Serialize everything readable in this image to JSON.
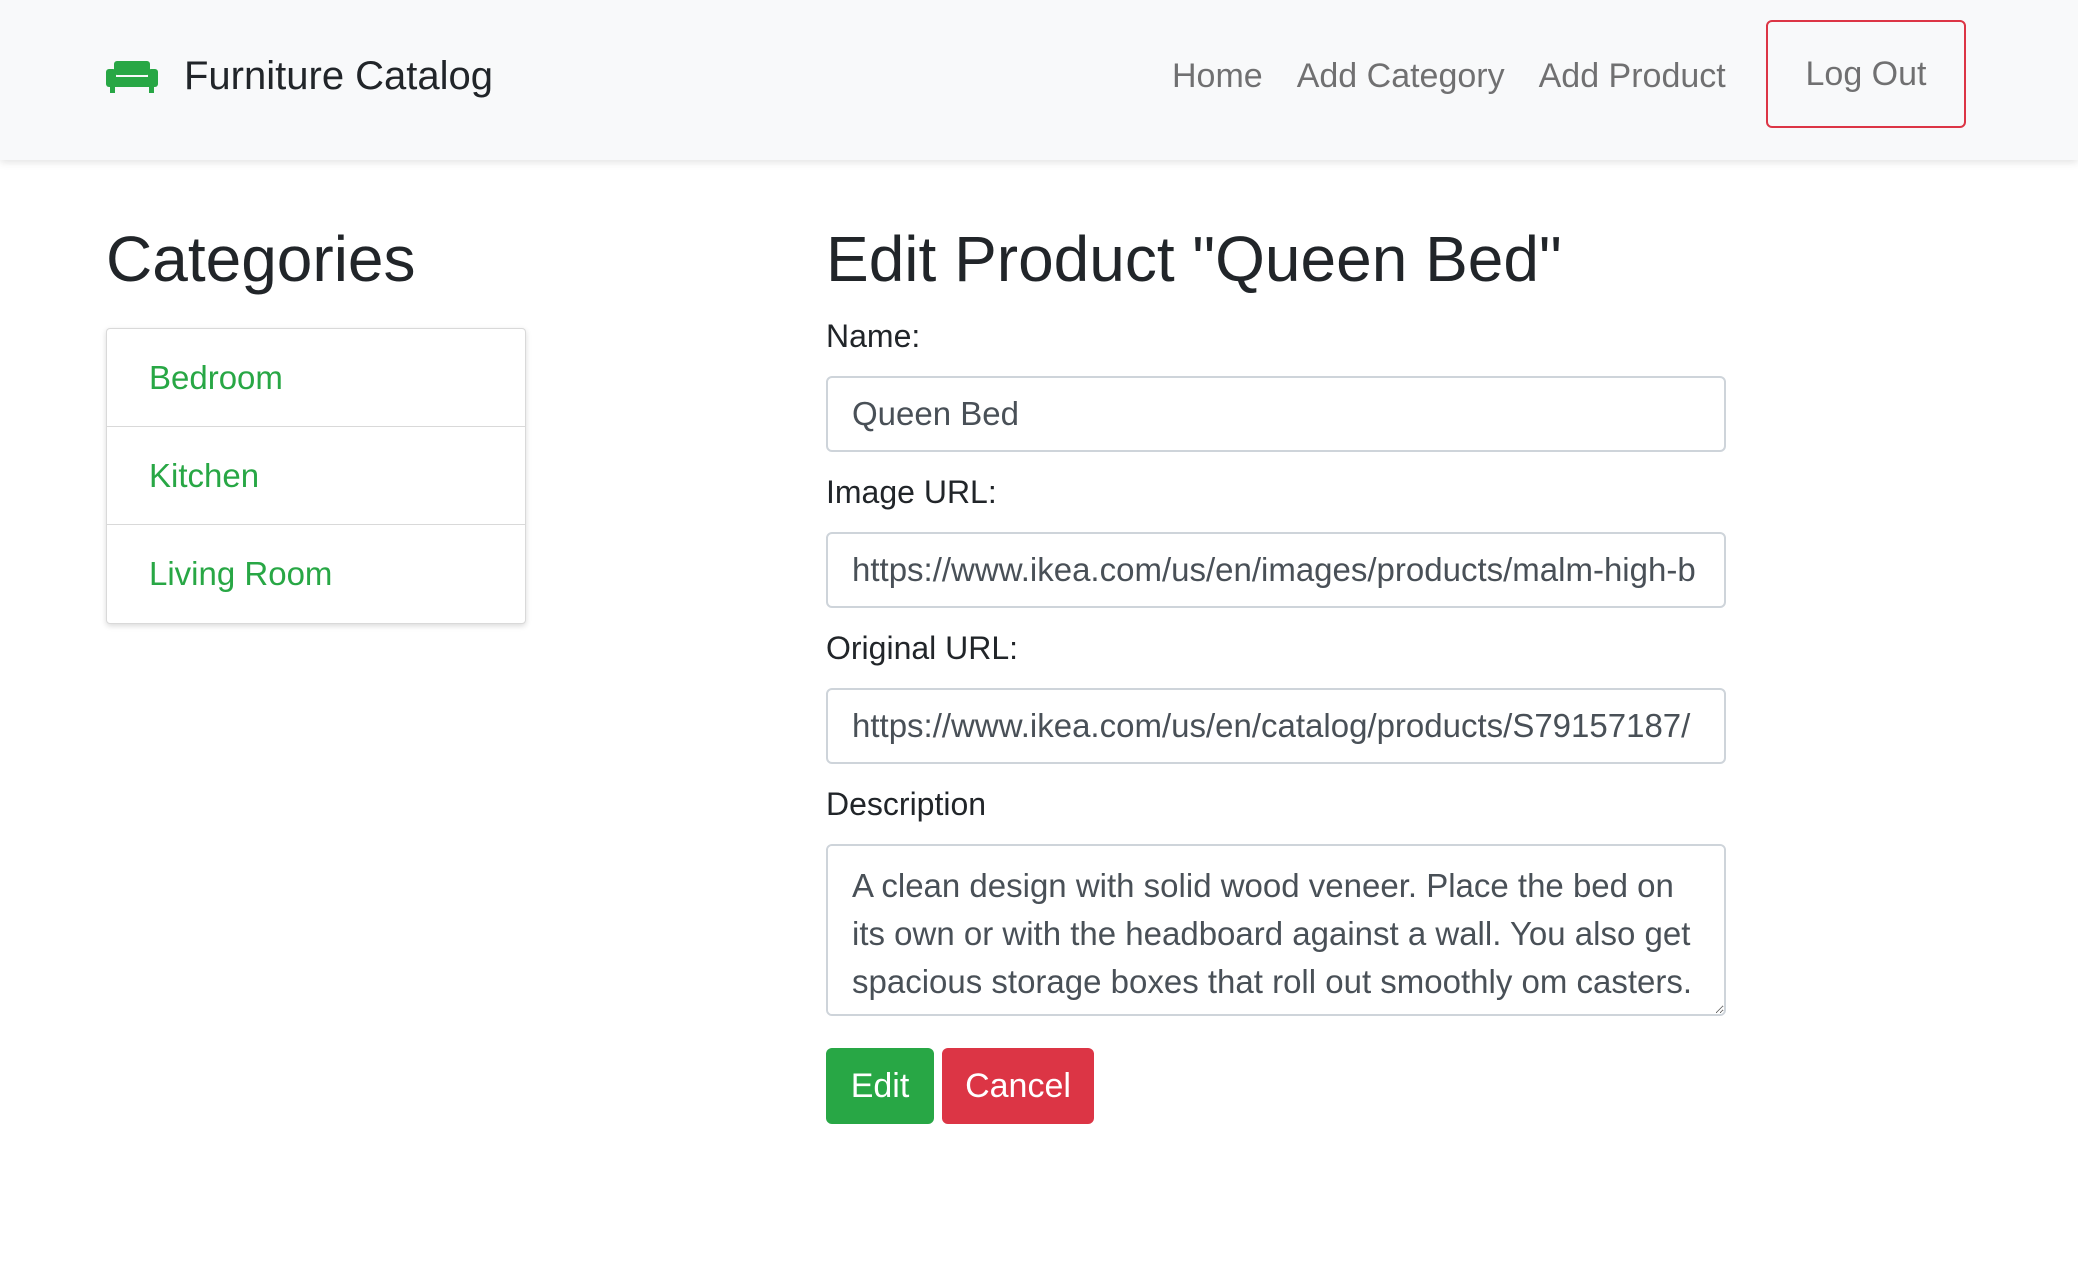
{
  "navbar": {
    "brand_icon": "sofa-icon",
    "brand": "Furniture Catalog",
    "links": [
      "Home",
      "Add Category",
      "Add Product"
    ],
    "logout_label": "Log Out"
  },
  "sidebar": {
    "title": "Categories",
    "items": [
      "Bedroom",
      "Kitchen",
      "Living Room"
    ]
  },
  "form": {
    "title": "Edit Product \"Queen Bed\"",
    "name_label": "Name:",
    "name_value": "Queen Bed",
    "image_label": "Image URL:",
    "image_value": "https://www.ikea.com/us/en/images/products/malm-high-b",
    "original_label": "Original URL:",
    "original_value": "https://www.ikea.com/us/en/catalog/products/S79157187/",
    "description_label": "Description",
    "description_value": "A clean design with solid wood veneer. Place the bed on its own or with the headboard against a wall. You also get spacious storage boxes that roll out smoothly om casters.",
    "edit_label": "Edit",
    "cancel_label": "Cancel"
  },
  "colors": {
    "accent_green": "#28a745",
    "danger_red": "#dc3545",
    "navbar_bg": "#f8f9fa"
  }
}
